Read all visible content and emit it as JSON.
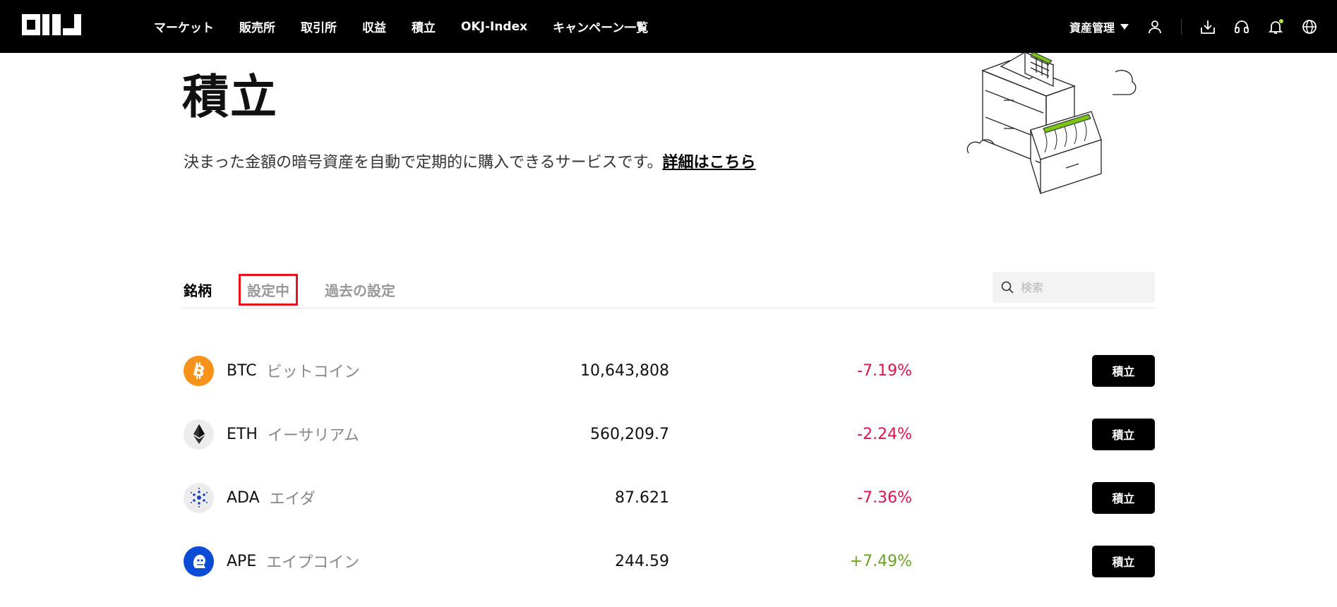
{
  "header": {
    "logo_text": "OKJ",
    "nav": [
      "マーケット",
      "販売所",
      "取引所",
      "収益",
      "積立",
      "OKJ-Index",
      "キャンペーン一覧"
    ],
    "asset_menu": "資産管理",
    "icons": [
      "user-icon",
      "download-icon",
      "headset-icon",
      "bell-icon",
      "globe-icon"
    ]
  },
  "hero": {
    "title": "積立",
    "description": "決まった金額の暗号資産を自動で定期的に購入できるサービスです。",
    "link": "詳細はこちら"
  },
  "tabs": [
    "銘柄",
    "設定中",
    "過去の設定"
  ],
  "search": {
    "placeholder": "検索"
  },
  "coins": [
    {
      "symbol": "BTC",
      "name": "ビットコイン",
      "price": "10,643,808",
      "change": "-7.19%",
      "direction": "down",
      "icon": "bitcoin-icon",
      "button": "積立"
    },
    {
      "symbol": "ETH",
      "name": "イーサリアム",
      "price": "560,209.7",
      "change": "-2.24%",
      "direction": "down",
      "icon": "ethereum-icon",
      "button": "積立"
    },
    {
      "symbol": "ADA",
      "name": "エイダ",
      "price": "87.621",
      "change": "-7.36%",
      "direction": "down",
      "icon": "cardano-icon",
      "button": "積立"
    },
    {
      "symbol": "APE",
      "name": "エイプコイン",
      "price": "244.59",
      "change": "+7.49%",
      "direction": "up",
      "icon": "apecoin-icon",
      "button": "積立"
    }
  ],
  "colors": {
    "negative": "#e0144c",
    "positive": "#6aa126",
    "highlight": "#e8121f",
    "accent": "#b8e636"
  }
}
